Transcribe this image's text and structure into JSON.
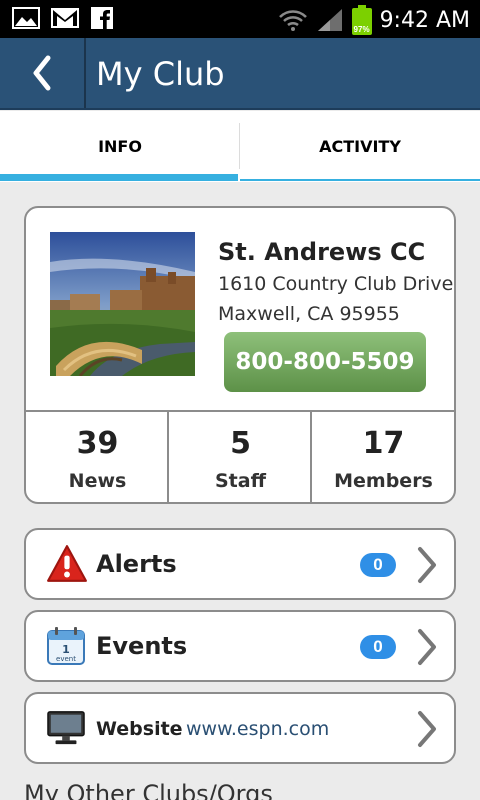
{
  "status_bar": {
    "time": "9:42 AM",
    "battery_percent": "97%",
    "icons": [
      "picture-icon",
      "gmail-icon",
      "facebook-icon",
      "wifi-icon",
      "signal-icon",
      "battery-icon"
    ]
  },
  "app_bar": {
    "title": "My Club",
    "back_icon": "chevron-left-icon",
    "color": "#2a5277"
  },
  "tabs": [
    {
      "label": "INFO",
      "active": true
    },
    {
      "label": "ACTIVITY",
      "active": false
    }
  ],
  "accent_color": "#36b0e0",
  "club": {
    "name": "St. Andrews CC",
    "address_line1": "1610 Country Club Drive",
    "address_line2": "Maxwell, CA 95955",
    "phone": "800-800-5509",
    "phone_button_color": "#6fa558",
    "stats": [
      {
        "value": "39",
        "label": "News"
      },
      {
        "value": "5",
        "label": "Staff"
      },
      {
        "value": "17",
        "label": "Members"
      }
    ]
  },
  "rows": {
    "alerts": {
      "label": "Alerts",
      "badge": "0",
      "icon": "warning-icon"
    },
    "events": {
      "label": "Events",
      "badge": "0",
      "icon": "calendar-icon"
    },
    "website": {
      "label": "Website",
      "url": "www.espn.com",
      "icon": "monitor-icon"
    }
  },
  "calendar_icon_day": "1",
  "calendar_icon_word": "event",
  "section_heading": "My Other Clubs/Orgs",
  "badge_color": "#2f8fe6"
}
